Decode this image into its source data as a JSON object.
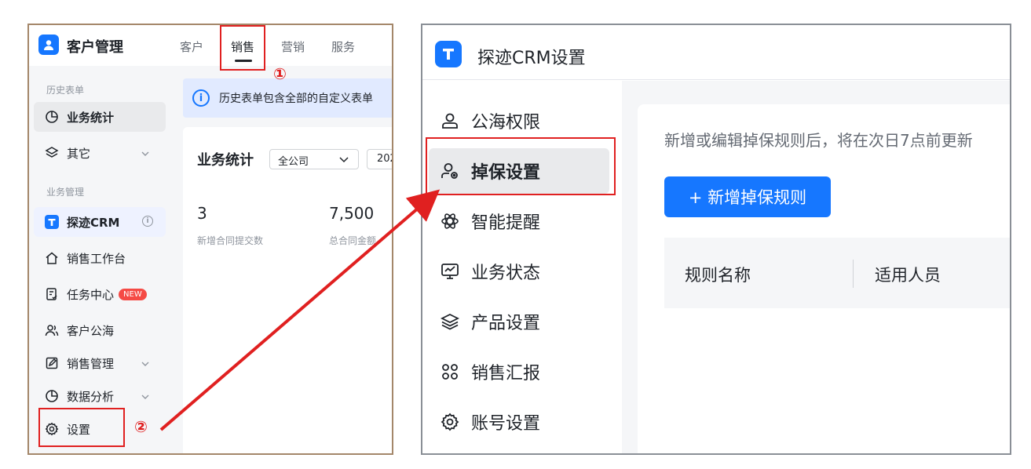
{
  "left": {
    "app_title": "客户管理",
    "tabs": [
      "客户",
      "销售",
      "营销",
      "服务"
    ],
    "active_tab": "销售",
    "annotation_1": "①",
    "annotation_2": "②",
    "sidebar": {
      "section_history": "历史表单",
      "item_stats": "业务统计",
      "item_other": "其它",
      "section_business": "业务管理",
      "item_crm": "探迹CRM",
      "item_workbench": "销售工作台",
      "item_tasks": "任务中心",
      "badge_new": "NEW",
      "item_customer_pool": "客户公海",
      "item_sales_mgmt": "销售管理",
      "item_analysis": "数据分析",
      "item_settings": "设置"
    },
    "info_text": "历史表单包含全部的自定义表单",
    "stats": {
      "title": "业务统计",
      "scope": "全公司",
      "year_partial": "202",
      "value_1": "3",
      "label_1": "新增合同提交数",
      "value_2": "7,500",
      "label_2": "总合同金额"
    }
  },
  "right": {
    "title": "探迹CRM设置",
    "menu": [
      "公海权限",
      "掉保设置",
      "智能提醒",
      "业务状态",
      "产品设置",
      "销售汇报",
      "账号设置"
    ],
    "selected_menu": "掉保设置",
    "notice": "新增或编辑掉保规则后，将在次日7点前更新",
    "add_button": "+ 新增掉保规则",
    "columns": [
      "规则名称",
      "适用人员"
    ]
  },
  "colors": {
    "accent": "#1677ff",
    "annotation": "#e02020",
    "left_border": "#a4876a",
    "right_border": "#8a8f96"
  }
}
